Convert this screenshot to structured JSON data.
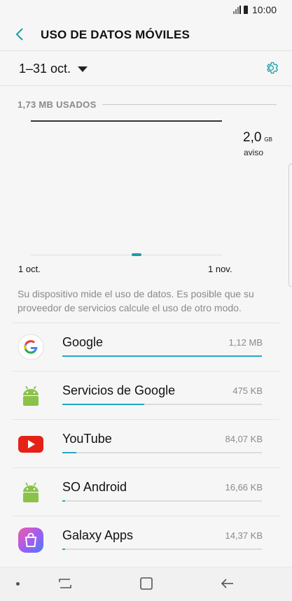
{
  "status": {
    "time": "10:00"
  },
  "header": {
    "title": "USO DE DATOS MÓVILES"
  },
  "period": {
    "label": "1–31 oct."
  },
  "usage": {
    "used_label": "1,73 MB USADOS"
  },
  "chart_data": {
    "type": "area",
    "x_start_label": "1 oct.",
    "x_end_label": "1 nov.",
    "limit_value": "2,0",
    "limit_unit": "GB",
    "limit_note": "aviso",
    "used_mb": 1.73,
    "limit_gb": 2.0
  },
  "info_text": "Su dispositivo mide el uso de datos. Es posible que su proveedor de servicios calcule el uso de otro modo.",
  "apps": [
    {
      "name": "Google",
      "size": "1,12 MB",
      "usage_fraction": 1.0,
      "icon": "google-icon"
    },
    {
      "name": "Servicios de Google",
      "size": "475 KB",
      "usage_fraction": 0.41,
      "icon": "android-icon"
    },
    {
      "name": "YouTube",
      "size": "84,07 KB",
      "usage_fraction": 0.07,
      "icon": "youtube-icon"
    },
    {
      "name": "SO Android",
      "size": "16,66 KB",
      "usage_fraction": 0.015,
      "icon": "android-icon"
    },
    {
      "name": "Galaxy Apps",
      "size": "14,37 KB",
      "usage_fraction": 0.013,
      "icon": "galaxy-apps-icon"
    }
  ],
  "colors": {
    "accent": "#23a8c4",
    "chart_mark": "#1a9ea8"
  }
}
